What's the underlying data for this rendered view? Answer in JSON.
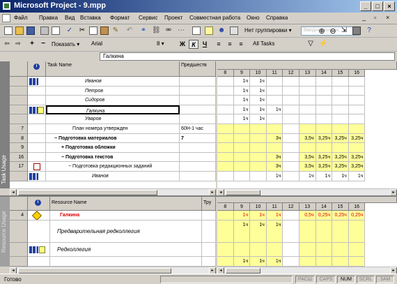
{
  "app": {
    "title": "Microsoft Project - 9.mpp"
  },
  "menu": {
    "items": [
      "Файл",
      "Правка",
      "Вид",
      "Вставка",
      "Формат",
      "Сервис",
      "Проект",
      "Совместная работа",
      "Окно",
      "Справка"
    ],
    "help_placeholder": "Введите вопрос"
  },
  "toolbar1": {
    "group_value": "Нет группировки"
  },
  "toolbar2": {
    "show_label": "Показать",
    "font": "Arial",
    "size": "8",
    "bold": "Ж",
    "italic": "К",
    "underline": "Ч",
    "filter": "All Tasks"
  },
  "entry": {
    "value": "Галкина"
  },
  "views": {
    "top": "Task Usage",
    "bottom": "Resource Usage"
  },
  "task_grid": {
    "col_task_name": "Task Name",
    "col_pred": "Предшеств",
    "days": [
      "8",
      "9",
      "10",
      "11",
      "12",
      "13",
      "14",
      "15",
      "16"
    ],
    "rows": [
      {
        "id": "",
        "name": "Иванов",
        "pred": "",
        "vals": [
          "",
          "1ч",
          "1ч",
          "",
          "",
          "",
          "",
          "",
          ""
        ]
      },
      {
        "id": "",
        "name": "Петров",
        "pred": "",
        "vals": [
          "",
          "1ч",
          "1ч",
          "",
          "",
          "",
          "",
          "",
          ""
        ]
      },
      {
        "id": "",
        "name": "Сидоров",
        "pred": "",
        "vals": [
          "",
          "1ч",
          "1ч",
          "",
          "",
          "",
          "",
          "",
          ""
        ]
      },
      {
        "id": "",
        "name": "Галкина",
        "pred": "",
        "vals": [
          "",
          "1ч",
          "1ч",
          "1ч",
          "",
          "",
          "",
          "",
          ""
        ]
      },
      {
        "id": "",
        "name": "Уваров",
        "pred": "",
        "vals": [
          "",
          "1ч",
          "1ч",
          "",
          "",
          "",
          "",
          "",
          ""
        ]
      },
      {
        "id": "7",
        "name": "План номера утвержден",
        "pred": "60Н-1 час",
        "vals": [
          "",
          "",
          "",
          "",
          "",
          "",
          "",
          "",
          ""
        ]
      },
      {
        "id": "8",
        "name": "Подготовка материалов",
        "pred": "7",
        "vals": [
          "",
          "",
          "",
          "3ч",
          "",
          "3,5ч",
          "3,25ч",
          "3,25ч",
          "3,25ч"
        ]
      },
      {
        "id": "9",
        "name": "Подготовка обложки",
        "pred": "",
        "vals": [
          "",
          "",
          "",
          "",
          "",
          "",
          "",
          "",
          ""
        ]
      },
      {
        "id": "16",
        "name": "Подготовка текстов",
        "pred": "",
        "vals": [
          "",
          "",
          "",
          "3ч",
          "",
          "3,5ч",
          "3,25ч",
          "3,25ч",
          "3,25ч"
        ]
      },
      {
        "id": "17",
        "name": "Подготовка редакционных заданий",
        "pred": "",
        "vals": [
          "",
          "",
          "",
          "3ч",
          "",
          "3,5ч",
          "3,25ч",
          "3,25ч",
          "3,25ч"
        ]
      },
      {
        "id": "",
        "name": "Иванов",
        "pred": "",
        "vals": [
          "",
          "",
          "",
          "1ч",
          "",
          "1ч",
          "1ч",
          "1ч",
          "1ч"
        ]
      }
    ]
  },
  "resource_grid": {
    "col_resource_name": "Resource Name",
    "col_work": "Тру",
    "days": [
      "8",
      "9",
      "10",
      "11",
      "12",
      "13",
      "14",
      "15",
      "16"
    ],
    "rows": [
      {
        "id": "4",
        "name": "Галкина",
        "vals": [
          "",
          "1ч",
          "1ч",
          "1ч",
          "",
          "0,5ч",
          "0,25ч",
          "0,25ч",
          "0,25ч"
        ]
      },
      {
        "id": "",
        "name": "Предварительная редколлегия",
        "vals": [
          "",
          "1ч",
          "1ч",
          "1ч",
          "",
          "",
          "",
          "",
          ""
        ]
      },
      {
        "id": "",
        "name": "Редколлегия",
        "vals": [
          "",
          "",
          "",
          "",
          "",
          "",
          "",
          "",
          ""
        ]
      },
      {
        "id": "",
        "name": "",
        "vals": [
          "",
          "1ч",
          "1ч",
          "1ч",
          "",
          "",
          "",
          "",
          ""
        ]
      }
    ]
  },
  "status": {
    "ready": "Готово",
    "ext": "РАСШ",
    "caps": "CAPS",
    "num": "NUM",
    "scrl": "SCRL",
    "ovr": "ЗАМ"
  }
}
